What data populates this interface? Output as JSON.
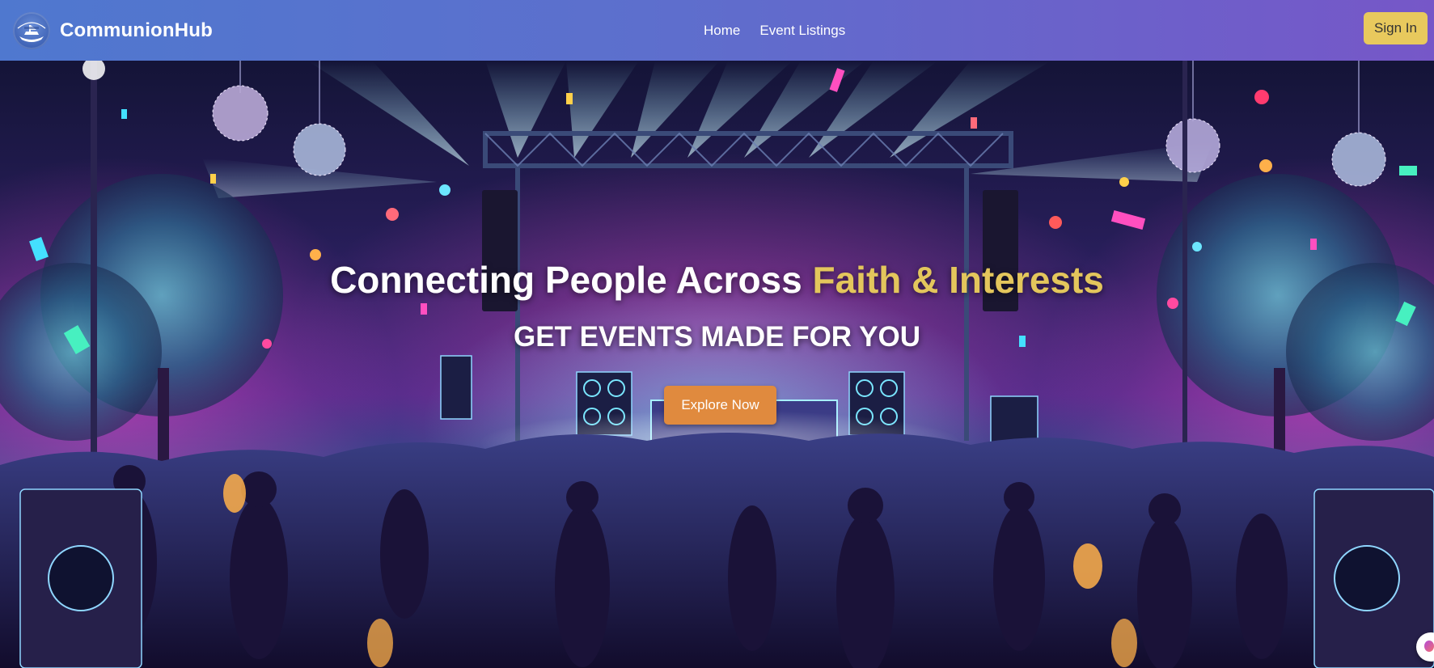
{
  "brand": {
    "name": "CommunionHub",
    "logo_icon": "boat-logo-icon"
  },
  "nav": {
    "links": [
      {
        "label": "Home"
      },
      {
        "label": "Event Listings"
      }
    ],
    "signin_label": "Sign In"
  },
  "hero": {
    "headline_main": "Connecting People Across ",
    "headline_accent": "Faith & Interests",
    "subheadline": "GET EVENTS MADE FOR YOU",
    "cta_label": "Explore Now",
    "background": "concert-crowd-stage-image"
  },
  "colors": {
    "nav_gradient_start": "#4f78cf",
    "nav_gradient_end": "#7657c8",
    "accent_gold": "#e3c65c",
    "signin_bg": "#e8c95d",
    "cta_bg": "#e08a3e"
  },
  "chat_widget": {
    "icon": "chat-bubble-icon"
  }
}
